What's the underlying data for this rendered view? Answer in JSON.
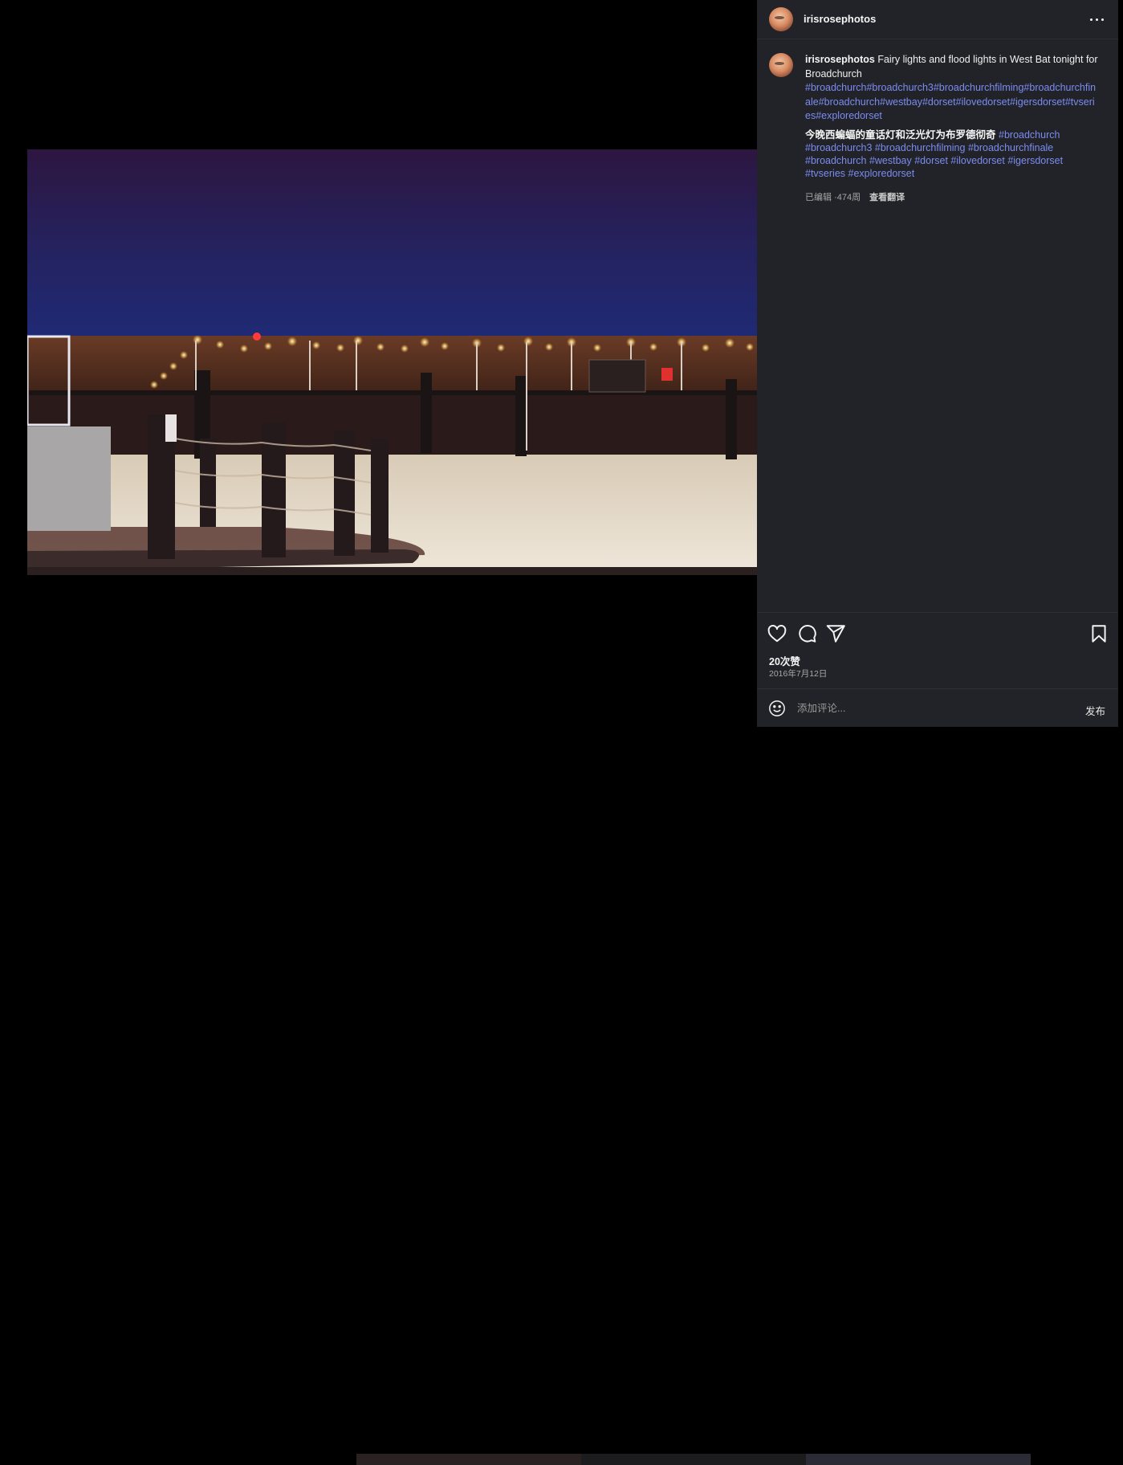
{
  "post": {
    "username": "irisrosephotos",
    "caption_text": "Fairy lights and flood lights in West Bat tonight for Broadchurch",
    "caption_tags": [
      "#broadchurch",
      "#broadchurch3",
      "#broadchurchfilming",
      "#broadchurchfinale",
      "#broadchurch",
      "#westbay",
      "#dorset",
      "#ilovedorset",
      "#igersdorset",
      "#tvseries",
      "#exploredorset"
    ],
    "translation_text": "今晚西蝙蝠的童话灯和泛光灯为布罗德彻奇",
    "translation_tags": [
      "#broadchurch",
      "#broadchurch3",
      "#broadchurchfilming",
      "#broadchurchfinale",
      "#broadchurch",
      "#westbay",
      "#dorset",
      "#ilovedorset",
      "#igersdorset",
      "#tvseries",
      "#exploredorset"
    ],
    "edited_label": "已编辑",
    "age": "474周",
    "see_translation": "查看翻译",
    "likes": "20次赞",
    "date": "2016年7月12日",
    "comment_placeholder": "添加评论...",
    "post_button": "发布"
  },
  "icons": {
    "more": "more-horizontal-icon",
    "like": "heart-icon",
    "comment": "comment-icon",
    "share": "share-icon",
    "save": "bookmark-icon",
    "emoji": "emoji-icon"
  },
  "colors": {
    "panel_bg": "#212328",
    "hashtag": "#7b8cf0",
    "page_bg": "#000000"
  }
}
